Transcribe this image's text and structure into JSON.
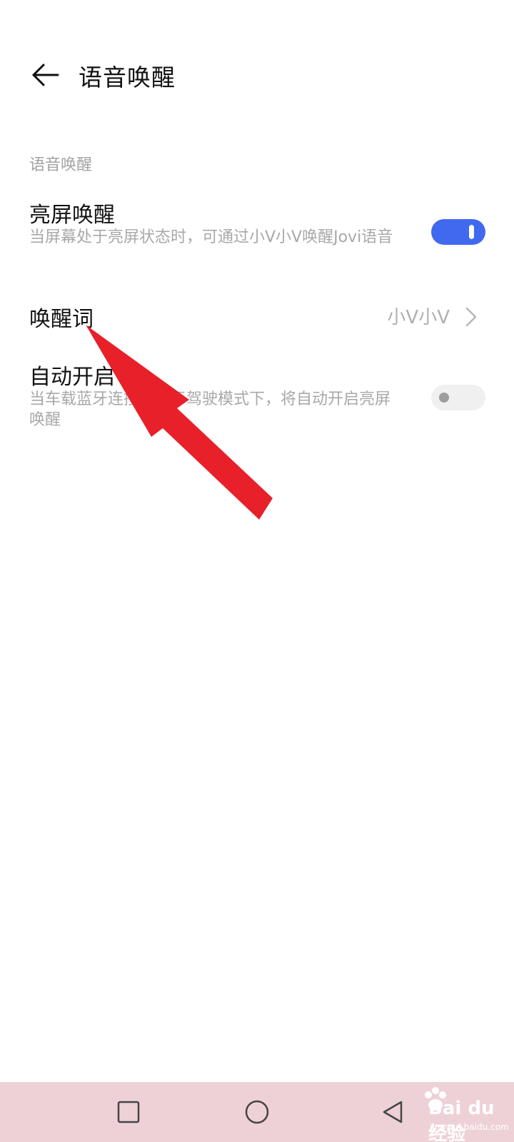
{
  "header": {
    "title": "语音唤醒"
  },
  "section": {
    "label": "语音唤醒"
  },
  "settings": {
    "screen_wake": {
      "title": "亮屏唤醒",
      "description": "当屏幕处于亮屏状态时，可通过小V小V唤醒Jovi语音",
      "enabled": true
    },
    "wake_word": {
      "title": "唤醒词",
      "value": "小V小V"
    },
    "auto_enable": {
      "title": "自动开启",
      "description": "当车载蓝牙连接或处于驾驶模式下，将自动开启亮屏唤醒",
      "enabled": false
    }
  },
  "navbar": {
    "recent_icon": "square-icon",
    "home_icon": "circle-icon",
    "back_icon": "triangle-back-icon"
  },
  "watermark": {
    "brand": "Bai du 经验",
    "site": "jingyan.baidu.com"
  },
  "colors": {
    "accent": "#4169f0",
    "annotation_arrow": "#e8202a",
    "navbar_bg": "#eed1d7"
  },
  "icons": {
    "back": "arrow-left-icon",
    "chevron": "chevron-right-icon",
    "annotation": "red-arrow-icon"
  }
}
